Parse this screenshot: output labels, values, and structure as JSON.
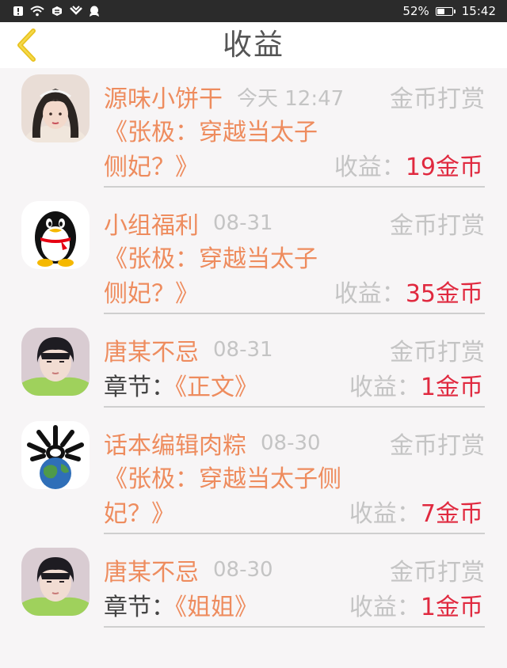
{
  "status_bar": {
    "battery": "52%",
    "battery_level": 0.52,
    "time": "15:42"
  },
  "header": {
    "title": "收益",
    "back_icon": "chevron-left-icon",
    "accent": "#e8c21f"
  },
  "colors": {
    "name": "#ee8c5e",
    "muted": "#c4c4c4",
    "amount": "#e0293f",
    "background": "#f7f5f6"
  },
  "entries": [
    {
      "name": "源味小饼干",
      "time": "今天 12:47",
      "type": "金币打赏",
      "work": "《张极：穿越当太子侧妃？》",
      "earn_label": "收益：",
      "earn_value": "19金币"
    },
    {
      "name": "小组福利",
      "time": "08-31",
      "type": "金币打赏",
      "work": "《张极：穿越当太子侧妃？》",
      "earn_label": "收益：",
      "earn_value": "35金币"
    },
    {
      "name": "唐某不忌",
      "time": "08-31",
      "type": "金币打赏",
      "chapter_prefix": "章节：",
      "chapter_name": "《正文》",
      "earn_label": "收益：",
      "earn_value": "1金币"
    },
    {
      "name": "话本编辑肉粽",
      "time": "08-30",
      "type": "金币打赏",
      "work": "《张极：穿越当太子侧妃？》",
      "earn_label": "收益：",
      "earn_value": "7金币"
    },
    {
      "name": "唐某不忌",
      "time": "08-30",
      "type": "金币打赏",
      "chapter_prefix": "章节：",
      "chapter_name": "《姐姐》",
      "earn_label": "收益：",
      "earn_value": "1金币"
    }
  ]
}
